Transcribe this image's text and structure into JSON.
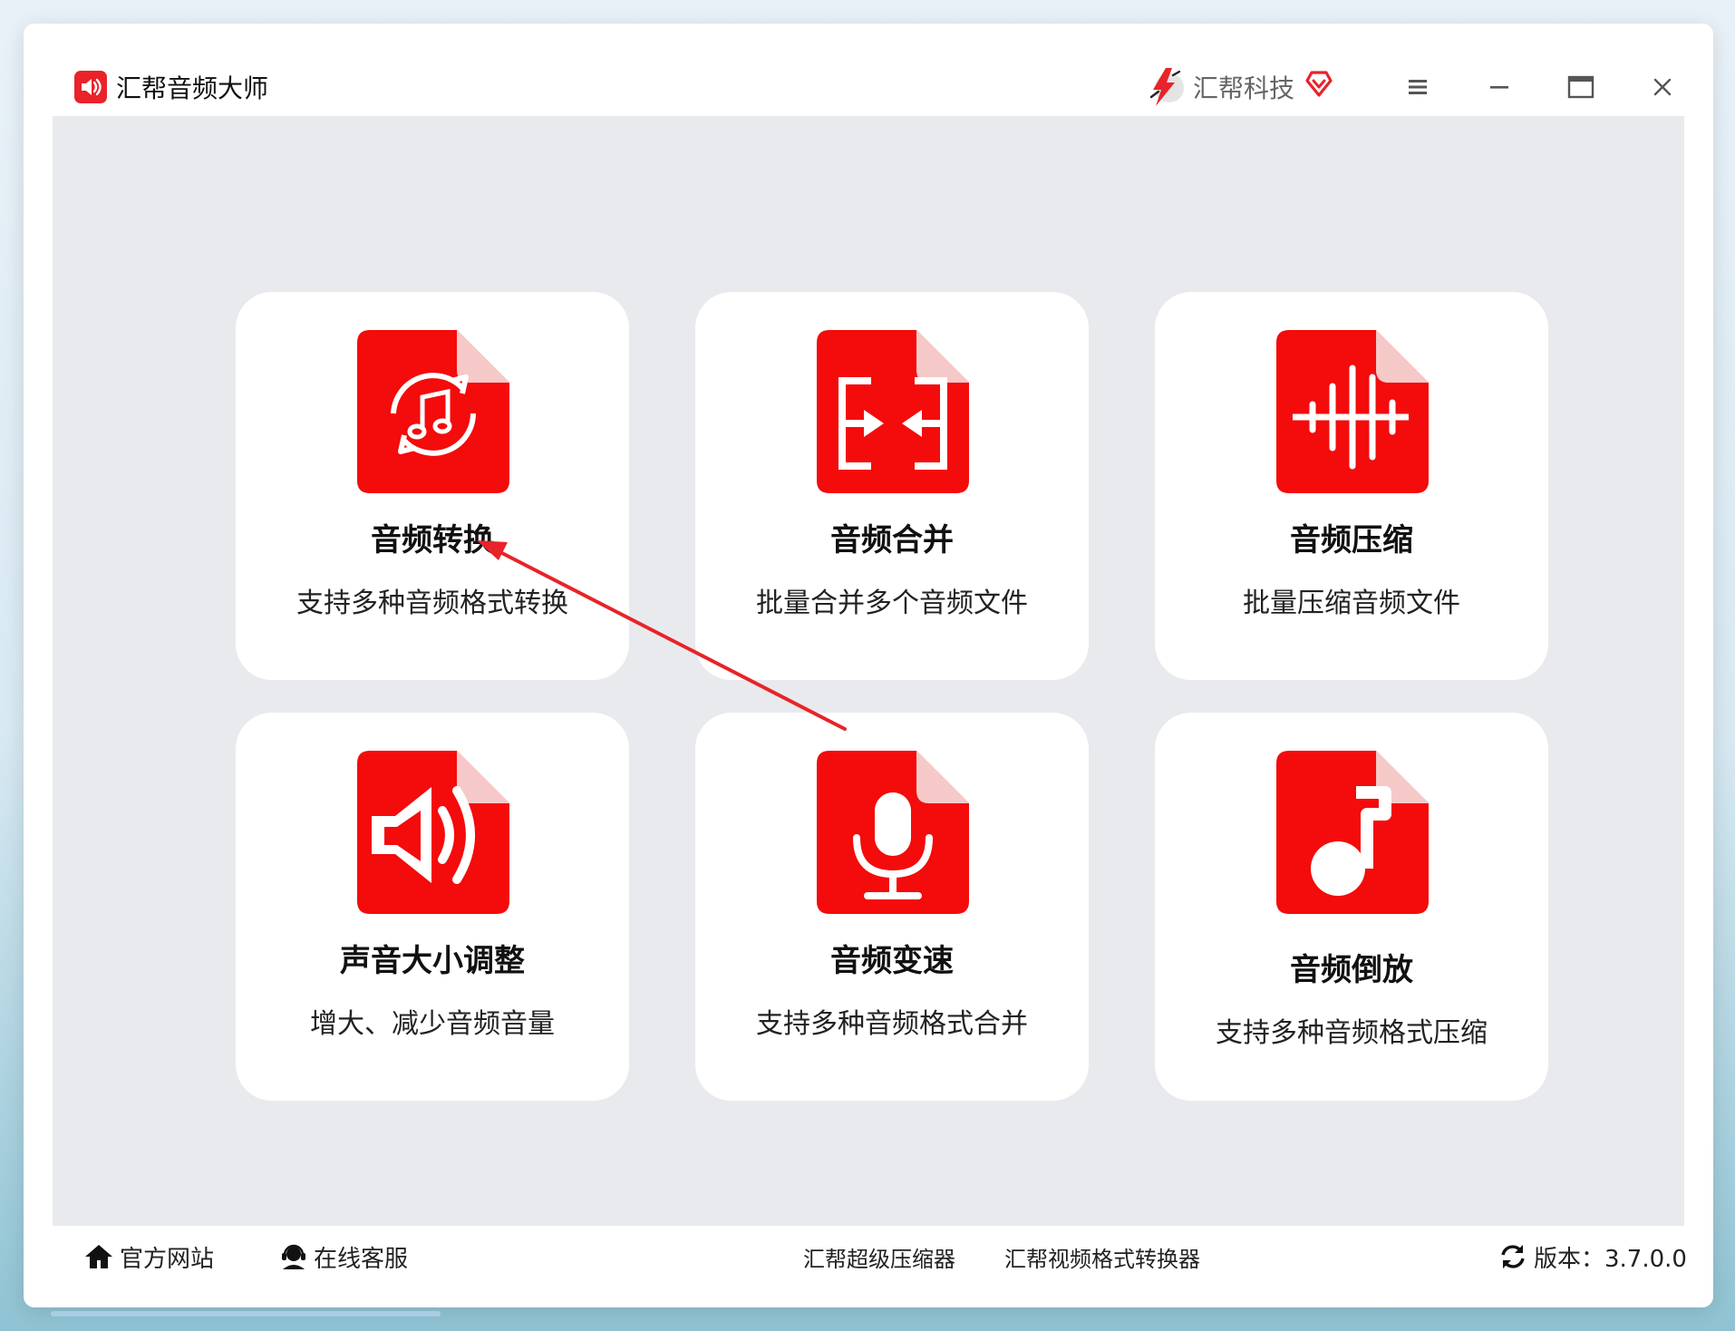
{
  "app": {
    "title": "汇帮音频大师",
    "brand_name": "汇帮科技",
    "accent_color": "#e8232a"
  },
  "cards": [
    {
      "title": "音频转换",
      "desc": "支持多种音频格式转换",
      "icon": "music-convert-icon"
    },
    {
      "title": "音频合并",
      "desc": "批量合并多个音频文件",
      "icon": "merge-icon"
    },
    {
      "title": "音频压缩",
      "desc": "批量压缩音频文件",
      "icon": "waveform-icon"
    },
    {
      "title": "声音大小调整",
      "desc": "增大、减少音频音量",
      "icon": "speaker-icon"
    },
    {
      "title": "音频变速",
      "desc": "支持多种音频格式合并",
      "icon": "microphone-icon"
    },
    {
      "title": "音频倒放",
      "desc": "支持多种音频格式压缩",
      "icon": "music-note-icon"
    }
  ],
  "footer": {
    "official_site": "官方网站",
    "online_service": "在线客服",
    "compressor_link": "汇帮超级压缩器",
    "video_converter_link": "汇帮视频格式转换器",
    "version": "版本：3.7.0.0"
  }
}
